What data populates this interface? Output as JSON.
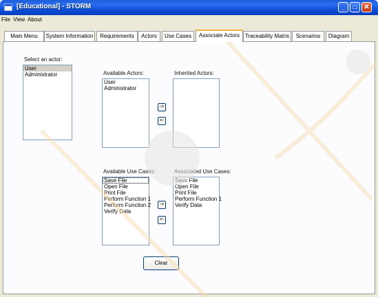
{
  "window": {
    "title": "[Educational] - STORM",
    "minimize_label": "_",
    "maximize_label": "□",
    "close_label": "✕"
  },
  "menu": [
    "File",
    "View",
    "About"
  ],
  "tabs": [
    {
      "label": "Main Menu",
      "active": false
    },
    {
      "label": "System Information",
      "active": false
    },
    {
      "label": "Requirements",
      "active": false
    },
    {
      "label": "Actors",
      "active": false
    },
    {
      "label": "Use Cases",
      "active": false
    },
    {
      "label": "Associate Actors",
      "active": true
    },
    {
      "label": "Traceability Matrix",
      "active": false
    },
    {
      "label": "Scenarios",
      "active": false
    },
    {
      "label": "Diagram",
      "active": false
    }
  ],
  "select_actor": {
    "label": "Select an actor:",
    "items": [
      "User",
      "Administrator"
    ],
    "selected_index": 0
  },
  "available_actors": {
    "label": "Available Actors:",
    "items": [
      "User",
      "Administrator"
    ]
  },
  "inherited_actors": {
    "label": "Inherited Actors:",
    "items": []
  },
  "actor_buttons": {
    "add": "->",
    "remove": "<-"
  },
  "available_use_cases": {
    "label": "Available Use Cases:",
    "items": [
      "Save File",
      "Open File",
      "Print File",
      "Perform Function 1",
      "Perform Function 2",
      "Verify Data"
    ],
    "focused_index": 0
  },
  "associated_use_cases": {
    "label": "Associated Use Cases:",
    "items": [
      "Save File",
      "Open File",
      "Print File",
      "Perform Function 1",
      "Verify Data"
    ]
  },
  "use_case_buttons": {
    "add": "->",
    "remove": "<-"
  },
  "clear_button": "Clear",
  "colors": {
    "titlebar": "#0a4ad0",
    "active_tab_accent": "#f3b43e",
    "panel_bg": "#fcfcfe"
  }
}
